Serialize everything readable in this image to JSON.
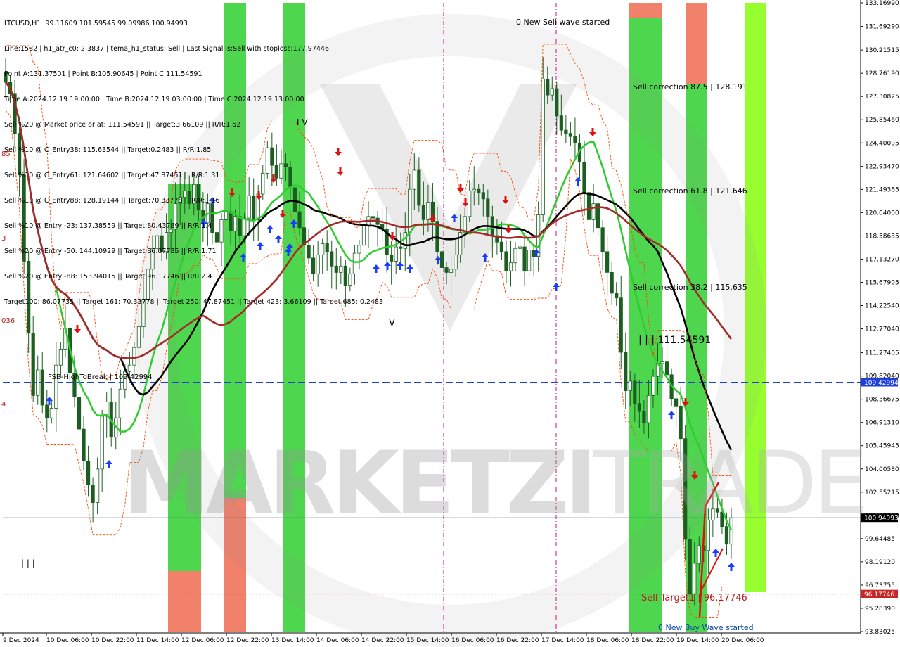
{
  "chart_data": {
    "type": "candlestick",
    "symbol": "LTCUSD,H1",
    "header_ohlc": "99.11609 101.59545 99.09986 100.94993",
    "info_lines": [
      "Line:1582 | h1_atr_c0: 2.3837 | tema_h1_status: Sell | Last Signal is:Sell with stoploss:177.97446",
      "Point A:131.37501 | Point B:105.90645 | Point C:111.54591",
      "Time A:2024.12.19 19:00:00 | Time B:2024.12.19 03:00:00 | Time C:2024.12.19 13:00:00",
      "Sell %20 @ Market price or at: 111.54591 || Target:3.66109 || R/R:1.62",
      "Sell %10 @ C_Entry38: 115.63544 || Target:0.2483 || R/R:1.85",
      "Sell %10 @ C_Entry61: 121.64602 || Target:47.87451 || R/R:1.31",
      "Sell %10 @ C_Entry88: 128.19144 || Target:70.33778 || R/R:1.16",
      "Sell %10 @ Entry -23: 137.38559 || Target:80.43789 || R/R:1.4",
      "Sell %20 @ Entry -50: 144.10929 || Target:86.07735 || R/R:1.71",
      "Sell %20 @ Entry -88: 153.94015 || Target:96.17746 || R/R:2.4",
      "Target100: 86.07735 || Target 161: 70.33778 || Target 250: 47.87451 || Target 423: 3.66109 || Target 685: 0.2483"
    ],
    "y_ticks": [
      "133.16990",
      "131.69290",
      "130.21515",
      "128.76190",
      "127.30825",
      "125.85460",
      "124.40095",
      "122.93470",
      "121.49365",
      "120.04000",
      "118.58635",
      "117.13270",
      "115.67905",
      "114.22540",
      "112.77040",
      "111.27405",
      "109.82040",
      "108.36675",
      "106.91310",
      "105.45945",
      "104.00580",
      "102.55215",
      "101.09850",
      "99.64485",
      "98.19120",
      "96.73755",
      "95.28390",
      "93.83025"
    ],
    "y_range": [
      93.83025,
      133.1699
    ],
    "x_ticks": [
      "9 Dec 2024",
      "10 Dec 06:00",
      "10 Dec 22:00",
      "11 Dec 14:00",
      "12 Dec 06:00",
      "12 Dec 22:00",
      "13 Dec 14:00",
      "14 Dec 06:00",
      "14 Dec 22:00",
      "15 Dec 14:00",
      "16 Dec 06:00",
      "16 Dec 22:00",
      "17 Dec 14:00",
      "18 Dec 06:00",
      "18 Dec 22:00",
      "19 Dec 14:00",
      "20 Dec 06:00"
    ],
    "price_labels": [
      {
        "value": 109.42994,
        "text": "109.42994",
        "color": "#1e3fd8"
      },
      {
        "value": 100.94993,
        "text": "100.94993",
        "color": "#000000"
      },
      {
        "value": 96.17746,
        "text": "96.17746",
        "color": "#c62828"
      }
    ],
    "close_series": [
      128.2,
      127.5,
      125.0,
      122.4,
      117.0,
      112.5,
      108.6,
      110.2,
      108.0,
      107.2,
      107.8,
      110.5,
      111.5,
      112.8,
      110.0,
      108.5,
      106.5,
      104.5,
      103.0,
      101.9,
      104.0,
      107.3,
      108.2,
      106.0,
      107.2,
      109.0,
      110.1,
      110.5,
      111.6,
      112.9,
      114.6,
      116.5,
      117.8,
      118.6,
      117.6,
      118.8,
      119.0,
      120.6,
      121.0,
      121.4,
      120.6,
      121.8,
      120.2,
      119.4,
      120.6,
      118.8,
      118.2,
      119.6,
      120.1,
      118.9,
      119.8,
      118.6,
      119.7,
      121.1,
      119.6,
      121.2,
      122.5,
      124.1,
      123.0,
      122.2,
      123.1,
      122.9,
      121.6,
      120.1,
      119.1,
      118.0,
      117.2,
      116.2,
      117.4,
      118.1,
      117.6,
      116.7,
      116.3,
      116.7,
      115.5,
      116.2,
      117.5,
      118.0,
      119.2,
      119.8,
      119.7,
      119.3,
      119.0,
      117.4,
      117.0,
      117.9,
      117.8,
      118.8,
      121.5,
      122.7,
      120.5,
      119.6,
      120.7,
      119.5,
      117.6,
      116.6,
      116.3,
      116.5,
      117.4,
      118.8,
      119.8,
      121.4,
      121.5,
      121.3,
      120.9,
      119.8,
      118.6,
      118.2,
      117.6,
      116.4,
      116.9,
      117.8,
      117.9,
      116.4,
      117.7,
      117.3,
      119.9,
      128.4,
      127.4,
      127.8,
      126.1,
      125.2,
      125.0,
      124.8,
      124.4,
      123.2,
      121.3,
      119.6,
      120.6,
      119.1,
      117.6,
      116.3,
      115.0,
      114.7,
      111.3,
      108.9,
      109.5,
      108.1,
      107.6,
      106.9,
      108.6,
      109.8,
      110.6,
      110.7,
      109.9,
      108.4,
      107.9,
      105.9,
      99.6,
      96.2,
      98.1,
      99.2,
      98.9,
      100.8,
      101.5,
      101.3,
      100.4,
      99.3,
      100.95
    ],
    "stats": {
      "open": 99.11609,
      "high": 101.59545,
      "low": 99.09986,
      "close": 100.94993
    }
  },
  "annotations": {
    "new_sell_wave": "0 New Sell wave started",
    "new_buy_wave": "0 New Buy Wave started",
    "sell_corr_875": "Sell correction 87.5 | 128.191",
    "sell_corr_618": "Sell correction 61.8 | 121.646",
    "sell_corr_382": "Sell correction 38.2 | 115.635",
    "sell_target": "Sell Target1 | 96.17746",
    "level_c": "| | | 111.54591",
    "fsb": "FSB-HighToBreak | 109.42994",
    "v_mark": "V",
    "iv_mark": "I V",
    "iii_mark": "| | |",
    "left_a": "85",
    "left_b": "3",
    "left_c": "036",
    "left_d": "4"
  },
  "watermark": {
    "bold": "MARKETZI",
    "thin": "TRADE"
  },
  "colors": {
    "zone_green": "#3fd43f",
    "zone_lime": "#8eff1e",
    "zone_red": "#ff7a6e",
    "bull_candle": "#1b5e20",
    "bear_candle": "#1b5e20",
    "ma_black": "#000000",
    "ma_brown": "#a52a2a",
    "ma_green": "#2ecc2e",
    "envelope": "#ff4500",
    "arrow_buy": "#1a3cff",
    "arrow_sell": "#e01010"
  }
}
